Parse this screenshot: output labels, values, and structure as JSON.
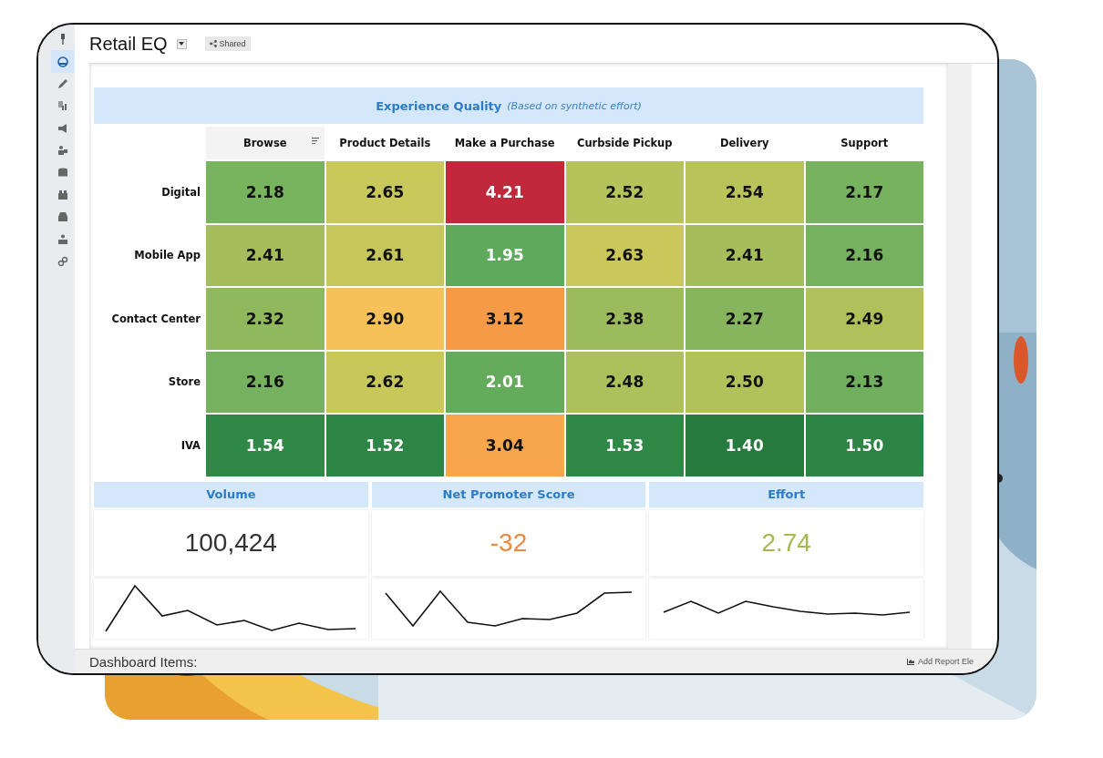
{
  "app": {
    "title": "Retail EQ",
    "shared_label": "Shared"
  },
  "sidebar": {
    "items": [
      {
        "selected": false
      },
      {
        "selected": true
      },
      {
        "selected": false
      },
      {
        "selected": false
      },
      {
        "selected": false
      },
      {
        "selected": false
      },
      {
        "selected": false
      },
      {
        "selected": false
      },
      {
        "selected": false
      },
      {
        "selected": false
      },
      {
        "selected": false
      }
    ]
  },
  "heatmap": {
    "title": "Experience Quality",
    "subtitle": "(Based on synthetic effort)",
    "columns": [
      {
        "label": "Browse",
        "sorted": true
      },
      {
        "label": "Product Details",
        "sorted": false
      },
      {
        "label": "Make a Purchase",
        "sorted": false
      },
      {
        "label": "Curbside Pickup",
        "sorted": false
      },
      {
        "label": "Delivery",
        "sorted": false
      },
      {
        "label": "Support",
        "sorted": false
      }
    ],
    "rows": [
      {
        "label": "Digital",
        "cells": [
          {
            "value": "2.18",
            "color": "#78b35e"
          },
          {
            "value": "2.65",
            "color": "#c9c85a"
          },
          {
            "value": "4.21",
            "color": "#c2283c"
          },
          {
            "value": "2.52",
            "color": "#b5c35a"
          },
          {
            "value": "2.54",
            "color": "#b8c45a"
          },
          {
            "value": "2.17",
            "color": "#77b25e"
          }
        ]
      },
      {
        "label": "Mobile App",
        "cells": [
          {
            "value": "2.41",
            "color": "#a5be5b"
          },
          {
            "value": "2.61",
            "color": "#c6c75a"
          },
          {
            "value": "1.95",
            "color": "#5ea95c"
          },
          {
            "value": "2.63",
            "color": "#cac85a"
          },
          {
            "value": "2.41",
            "color": "#a5be5b"
          },
          {
            "value": "2.16",
            "color": "#75b15e"
          }
        ]
      },
      {
        "label": "Contact Center",
        "cells": [
          {
            "value": "2.32",
            "color": "#90b85d"
          },
          {
            "value": "2.90",
            "color": "#f7c15a"
          },
          {
            "value": "3.12",
            "color": "#f59a46"
          },
          {
            "value": "2.38",
            "color": "#9cbb5c"
          },
          {
            "value": "2.27",
            "color": "#87b55d"
          },
          {
            "value": "2.49",
            "color": "#b0c15b"
          }
        ]
      },
      {
        "label": "Store",
        "cells": [
          {
            "value": "2.16",
            "color": "#75b15e"
          },
          {
            "value": "2.62",
            "color": "#c7c75a"
          },
          {
            "value": "2.01",
            "color": "#64ab5c"
          },
          {
            "value": "2.48",
            "color": "#aec05b"
          },
          {
            "value": "2.50",
            "color": "#b2c25b"
          },
          {
            "value": "2.13",
            "color": "#70af5d"
          }
        ]
      },
      {
        "label": "IVA",
        "cells": [
          {
            "value": "1.54",
            "color": "#2f8846"
          },
          {
            "value": "1.52",
            "color": "#2e8646"
          },
          {
            "value": "3.04",
            "color": "#f7a64d"
          },
          {
            "value": "1.53",
            "color": "#2f8846"
          },
          {
            "value": "1.40",
            "color": "#267a3e"
          },
          {
            "value": "1.50",
            "color": "#2d8445"
          }
        ]
      }
    ]
  },
  "kpis": [
    {
      "title": "Volume",
      "value": "100,424",
      "color": "#333333"
    },
    {
      "title": "Net Promoter Score",
      "value": "-32",
      "color": "#f0883a"
    },
    {
      "title": "Effort",
      "value": "2.74",
      "color": "#a6b84e"
    }
  ],
  "footer": {
    "label": "Dashboard Items:",
    "action": "Add Report Ele"
  }
}
